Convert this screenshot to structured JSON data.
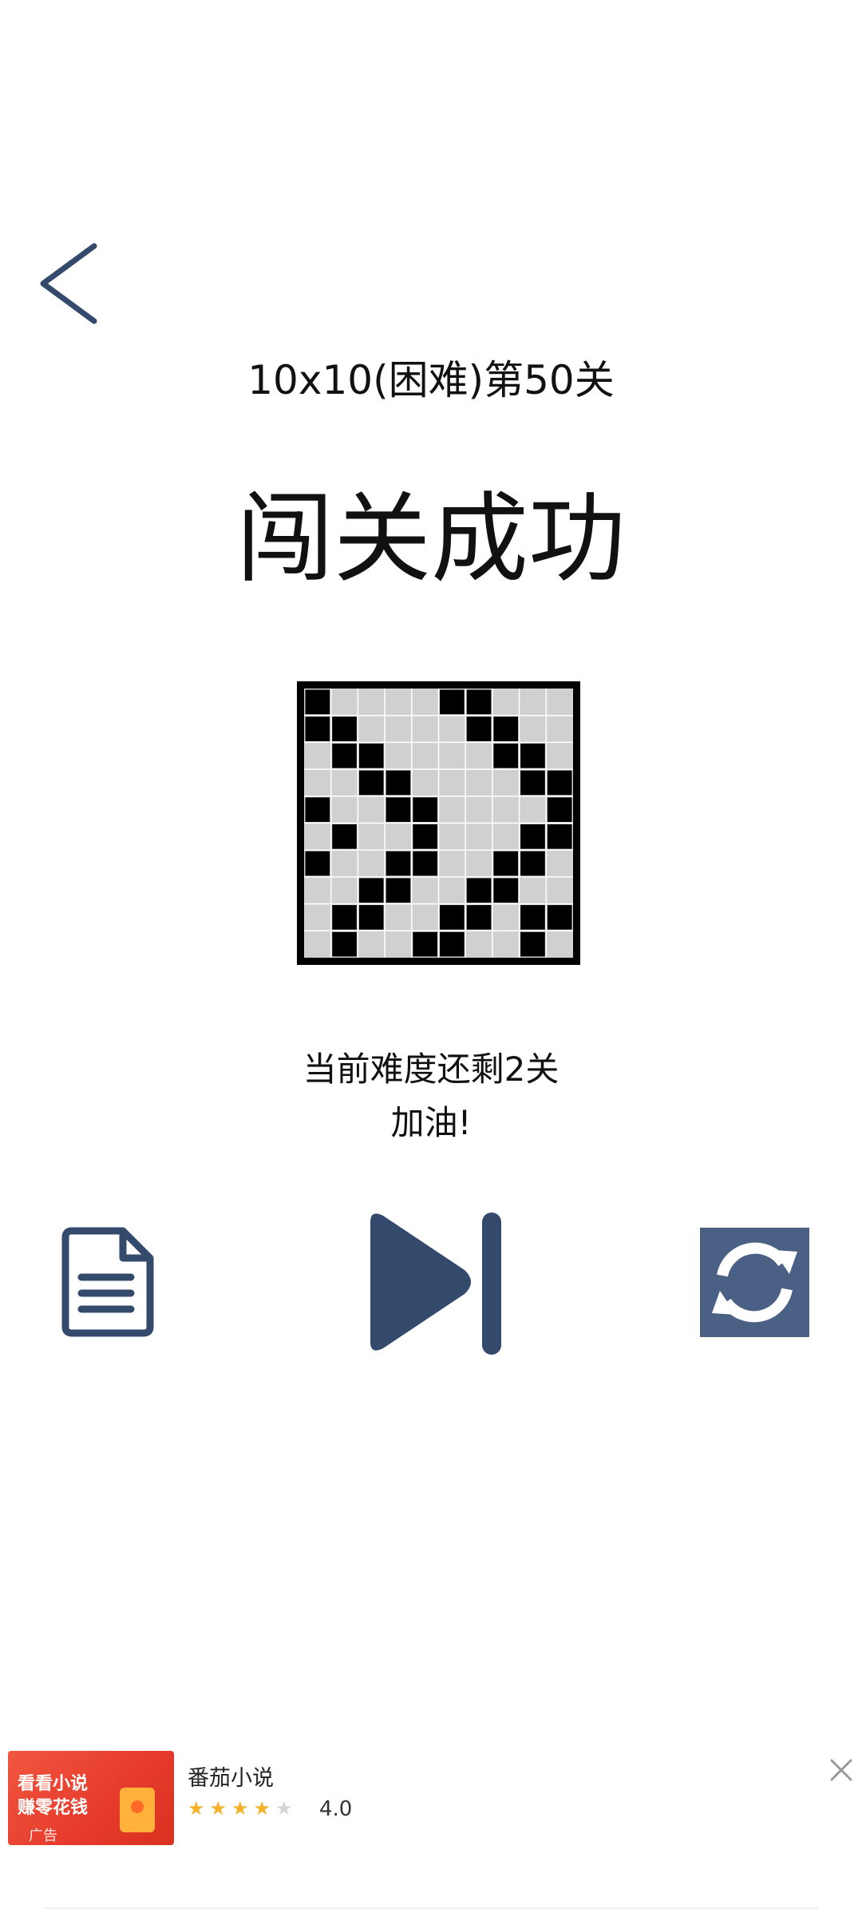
{
  "header": {
    "level_title": "10x10(困难)第50关",
    "success_title": "闯关成功"
  },
  "board": {
    "size": 10,
    "cells": [
      [
        1,
        0,
        0,
        0,
        0,
        1,
        1,
        0,
        0,
        0
      ],
      [
        1,
        1,
        0,
        0,
        0,
        0,
        1,
        1,
        0,
        0
      ],
      [
        0,
        1,
        1,
        0,
        0,
        0,
        0,
        1,
        1,
        0
      ],
      [
        0,
        0,
        1,
        1,
        0,
        0,
        0,
        0,
        1,
        1
      ],
      [
        1,
        0,
        0,
        1,
        1,
        0,
        0,
        0,
        0,
        1
      ],
      [
        0,
        1,
        0,
        0,
        1,
        0,
        0,
        0,
        1,
        1
      ],
      [
        1,
        0,
        0,
        1,
        1,
        0,
        0,
        1,
        1,
        0
      ],
      [
        0,
        0,
        1,
        1,
        0,
        0,
        1,
        1,
        0,
        0
      ],
      [
        0,
        1,
        1,
        0,
        0,
        1,
        1,
        0,
        1,
        1
      ],
      [
        0,
        1,
        0,
        0,
        1,
        1,
        0,
        0,
        1,
        0
      ]
    ]
  },
  "status": {
    "remaining": "当前难度还剩2关",
    "cheer": "加油!"
  },
  "controls": {
    "back_icon": "chevron-left-icon",
    "doc_icon": "document-icon",
    "next_icon": "skip-next-icon",
    "restart_icon": "refresh-icon",
    "accent_color": "#344a6c",
    "restart_bg_color": "#4a6185"
  },
  "ad": {
    "thumb_line1": "看看小说",
    "thumb_line2": "赚零花钱",
    "badge": "广告",
    "title": "番茄小说",
    "rating": "4.0",
    "stars_filled": 4,
    "stars_total": 5
  }
}
